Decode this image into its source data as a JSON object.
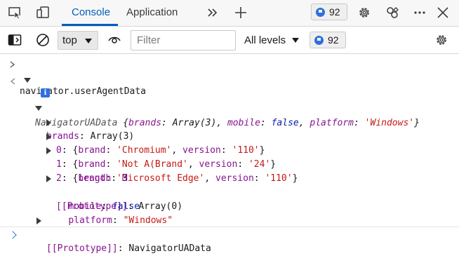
{
  "tabs": {
    "console_label": "Console",
    "application_label": "Application"
  },
  "tabbar": {
    "issues_count": "92"
  },
  "toolbar": {
    "context_value": "top",
    "filter_placeholder": "Filter",
    "levels_label": "All levels",
    "issues_count": "92"
  },
  "console": {
    "input_command": "navigator.userAgentData",
    "summary": {
      "class_name": "NavigatorUAData",
      "brands_key": "brands",
      "brands_value": "Array(3)",
      "mobile_key": "mobile",
      "mobile_value": "false",
      "platform_key": "platform",
      "platform_value": "'Windows'"
    },
    "brands_label": "brands",
    "brands_type": "Array(3)",
    "brand_entries": [
      {
        "index": "0",
        "brand": "'Chromium'",
        "version": "'110'"
      },
      {
        "index": "1",
        "brand": "'Not A(Brand'",
        "version": "'24'"
      },
      {
        "index": "2",
        "brand": "'Microsoft Edge'",
        "version": "'110'"
      }
    ],
    "length_key": "length",
    "length_value": "3",
    "array_prototype_key": "[[Prototype]]",
    "array_prototype_value": "Array(0)",
    "mobile_key": "mobile",
    "mobile_value": "false",
    "platform_key": "platform",
    "platform_value": "\"Windows\"",
    "object_prototype_key": "[[Prototype]]",
    "object_prototype_value": "NavigatorUAData",
    "brand_key": "brand",
    "version_key": "version"
  },
  "icons": [
    "inspect-icon",
    "device-emulation-icon",
    "more-tabs-icon",
    "add-tab-icon",
    "settings-icon",
    "customize-icon",
    "more-options-icon",
    "close-icon",
    "sidebar-icon",
    "clear-console-icon",
    "eye-icon",
    "info-icon"
  ],
  "colors": {
    "accent": "#005fb8",
    "property_key": "#881391",
    "string": "#c41a16",
    "keyword": "#0d22aa",
    "number": "#1c00cf"
  }
}
